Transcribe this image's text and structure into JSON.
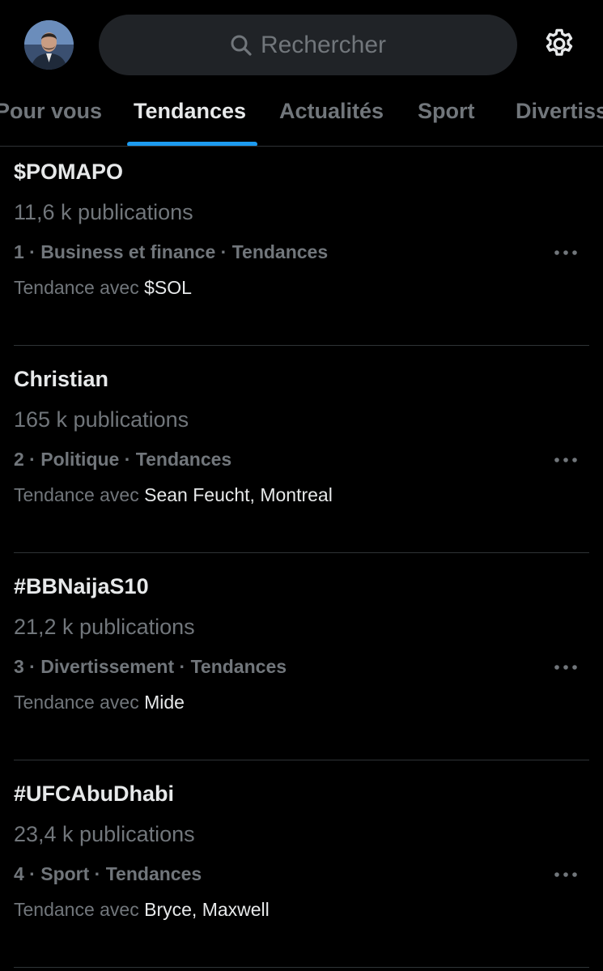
{
  "search": {
    "placeholder": "Rechercher"
  },
  "tabs": [
    {
      "label": "Pour vous",
      "active": false
    },
    {
      "label": "Tendances",
      "active": true
    },
    {
      "label": "Actualités",
      "active": false
    },
    {
      "label": "Sport",
      "active": false
    },
    {
      "label": "Divertissement",
      "active": false
    }
  ],
  "trends": [
    {
      "title": "$POMAPO",
      "count": "11,6 k publications",
      "meta": "1 · Business et finance · Tendances",
      "related_prefix": "Tendance avec",
      "related": "$SOL"
    },
    {
      "title": "Christian",
      "count": "165 k publications",
      "meta": "2 · Politique · Tendances",
      "related_prefix": "Tendance avec",
      "related": "Sean Feucht, Montreal"
    },
    {
      "title": "#BBNaijaS10",
      "count": "21,2 k publications",
      "meta": "3 · Divertissement · Tendances",
      "related_prefix": "Tendance avec",
      "related": "Mide"
    },
    {
      "title": "#UFCAbuDhabi",
      "count": "23,4 k publications",
      "meta": "4 · Sport · Tendances",
      "related_prefix": "Tendance avec",
      "related": "Bryce, Maxwell"
    }
  ],
  "colors": {
    "background": "#000000",
    "accent": "#1d9bf0",
    "text_primary": "#e7e9ea",
    "text_secondary": "#71767b",
    "search_bg": "#202327",
    "divider": "#2f3336"
  },
  "icons": {
    "search": "search-icon",
    "settings": "gear-icon",
    "more": "more-horizontal-icon"
  }
}
